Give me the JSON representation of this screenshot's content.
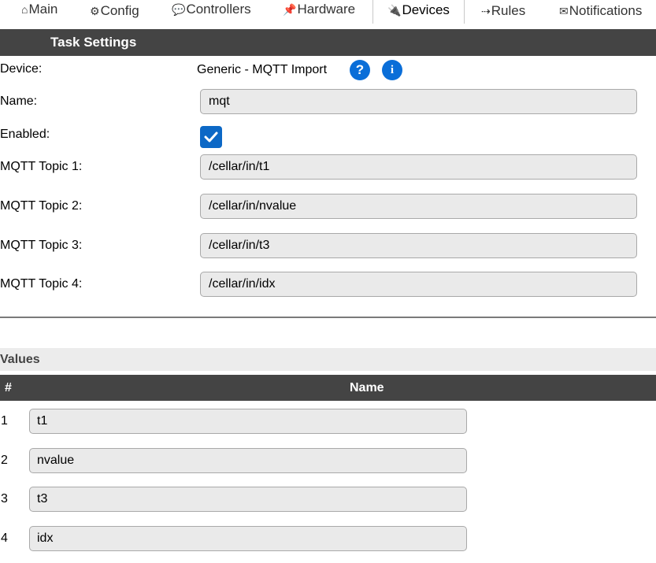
{
  "tabs": [
    {
      "icon": "⌂",
      "label": "Main"
    },
    {
      "icon": "⚙",
      "label": "Config"
    },
    {
      "icon": "💬",
      "label": "Controllers"
    },
    {
      "icon": "📌",
      "label": "Hardware"
    },
    {
      "icon": "🔌",
      "label": "Devices"
    },
    {
      "icon": "⇢",
      "label": "Rules"
    },
    {
      "icon": "✉",
      "label": "Notifications"
    }
  ],
  "section_title": "Task Settings",
  "device": {
    "label": "Device:",
    "value": "Generic - MQTT Import",
    "help_glyph": "?",
    "info_glyph": "i"
  },
  "name": {
    "label": "Name:",
    "value": "mqt"
  },
  "enabled": {
    "label": "Enabled:",
    "checked": true
  },
  "topics": [
    {
      "label": "MQTT Topic 1:",
      "value": "/cellar/in/t1"
    },
    {
      "label": "MQTT Topic 2:",
      "value": "/cellar/in/nvalue"
    },
    {
      "label": "MQTT Topic 3:",
      "value": "/cellar/in/t3"
    },
    {
      "label": "MQTT Topic 4:",
      "value": "/cellar/in/idx"
    }
  ],
  "values_title": "Values",
  "values_table": {
    "columns": [
      "#",
      "Name"
    ],
    "rows": [
      {
        "num": "1",
        "name": "t1"
      },
      {
        "num": "2",
        "name": "nvalue"
      },
      {
        "num": "3",
        "name": "t3"
      },
      {
        "num": "4",
        "name": "idx"
      }
    ]
  },
  "colors": {
    "header_bg": "#444444",
    "accent_blue": "#0a6ed8",
    "field_bg": "#eaeaea"
  }
}
